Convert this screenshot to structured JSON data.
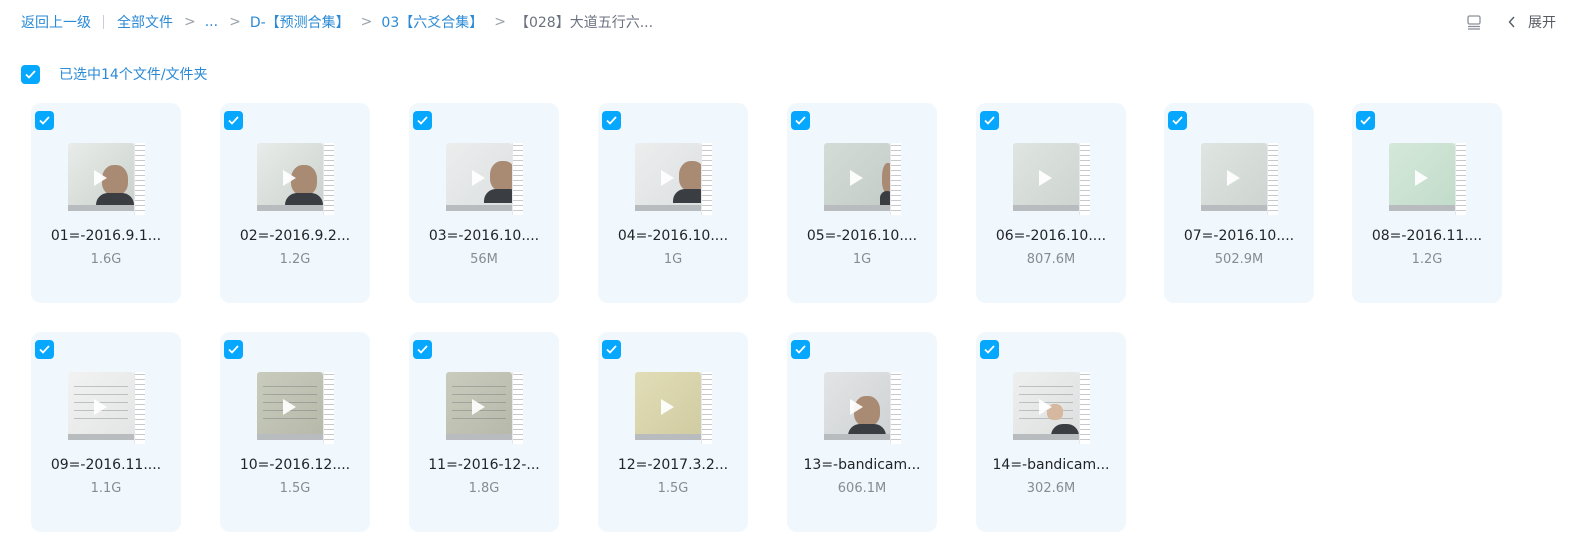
{
  "breadcrumb": {
    "back": "返回上一级",
    "root": "全部文件",
    "ellipsis": "...",
    "items": [
      "D-【预测合集】",
      "03【六爻合集】"
    ],
    "current": "【028】大道五行六..."
  },
  "toolbar": {
    "view_icon": "list-view-icon",
    "expand_label": "展开"
  },
  "selection": {
    "label": "已选中14个文件/文件夹",
    "all_checked": true
  },
  "colors": {
    "accent": "#06a7ff",
    "link": "#2b8ad6",
    "card_bg": "#f0f8fd"
  },
  "files": [
    {
      "name": "01=-2016.9.1...",
      "size": "1.6G",
      "thumb": "person",
      "checked": true
    },
    {
      "name": "02=-2016.9.2...",
      "size": "1.2G",
      "thumb": "person",
      "checked": true
    },
    {
      "name": "03=-2016.10....",
      "size": "56M",
      "thumb": "person-right",
      "checked": true
    },
    {
      "name": "04=-2016.10....",
      "size": "1G",
      "thumb": "person-right",
      "checked": true
    },
    {
      "name": "05=-2016.10....",
      "size": "1G",
      "thumb": "edge-person",
      "checked": true
    },
    {
      "name": "06=-2016.10....",
      "size": "807.6M",
      "thumb": "board",
      "checked": true
    },
    {
      "name": "07=-2016.10....",
      "size": "502.9M",
      "thumb": "board",
      "checked": true
    },
    {
      "name": "08=-2016.11....",
      "size": "1.2G",
      "thumb": "board-green",
      "checked": true
    },
    {
      "name": "09=-2016.11....",
      "size": "1.1G",
      "thumb": "writing",
      "checked": true
    },
    {
      "name": "10=-2016.12....",
      "size": "1.5G",
      "thumb": "writing-dark",
      "checked": true
    },
    {
      "name": "11=-2016-12-...",
      "size": "1.8G",
      "thumb": "writing-dark",
      "checked": true
    },
    {
      "name": "12=-2017.3.2...",
      "size": "1.5G",
      "thumb": "board-yellow",
      "checked": true
    },
    {
      "name": "13=-bandicam...",
      "size": "606.1M",
      "thumb": "person-wide",
      "checked": true
    },
    {
      "name": "14=-bandicam...",
      "size": "302.6M",
      "thumb": "writing-person",
      "checked": true
    }
  ]
}
